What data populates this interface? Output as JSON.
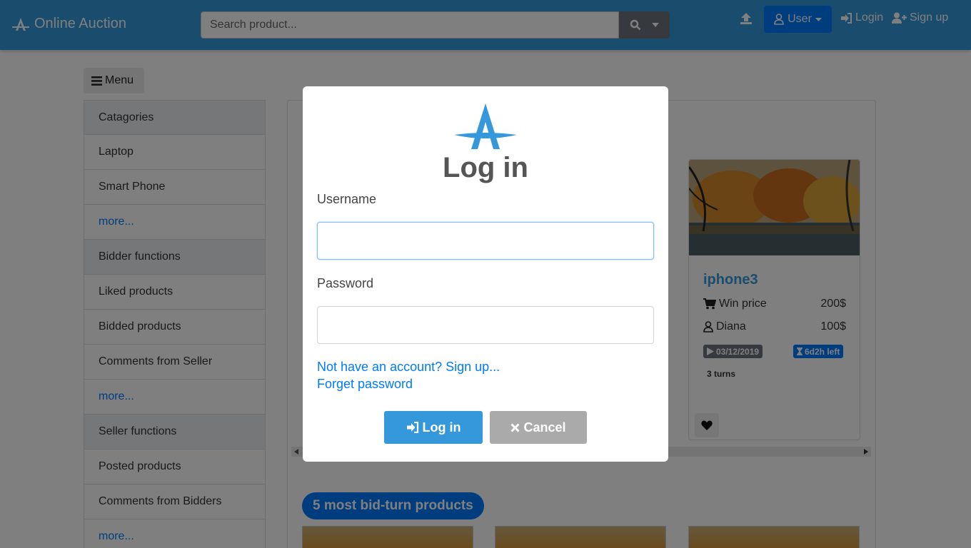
{
  "header": {
    "brand": "Online Auction",
    "search_placeholder": "Search product...",
    "user_button": "User",
    "login_link": "Login",
    "signup_link": "Sign up"
  },
  "menu_button": "Menu",
  "sidebar": {
    "items": [
      {
        "label": "Catagories",
        "kind": "head"
      },
      {
        "label": "Laptop",
        "kind": "item"
      },
      {
        "label": "Smart Phone",
        "kind": "item"
      },
      {
        "label": "more...",
        "kind": "more"
      },
      {
        "label": "Bidder functions",
        "kind": "head"
      },
      {
        "label": "Liked products",
        "kind": "item"
      },
      {
        "label": "Bidded products",
        "kind": "item"
      },
      {
        "label": "Comments from Seller",
        "kind": "item"
      },
      {
        "label": "more...",
        "kind": "more"
      },
      {
        "label": "Seller functions",
        "kind": "head"
      },
      {
        "label": "Posted products",
        "kind": "item"
      },
      {
        "label": "Comments from Bidders",
        "kind": "item"
      },
      {
        "label": "more...",
        "kind": "more"
      }
    ]
  },
  "product_card": {
    "name": "iphone3",
    "win_price_label": "Win price",
    "win_price_value": "200$",
    "bidder_name": "Diana",
    "bidder_value": "100$",
    "start_date": "03/12/2019",
    "time_left": "6d2h left",
    "turns": "3 turns"
  },
  "section_title": "5 most bid-turn products",
  "modal": {
    "title": "Log in",
    "username_label": "Username",
    "username_value": "",
    "password_label": "Password",
    "password_value": "",
    "signup_link": "Not have an account? Sign up...",
    "forgot_link": "Forget password",
    "login_button": "Log in",
    "cancel_button": "Cancel"
  },
  "colors": {
    "navbar": "#3498db",
    "primary": "#007bff",
    "cancel": "#aaaaaa",
    "overlay": "rgba(0,0,0,0.5)"
  }
}
